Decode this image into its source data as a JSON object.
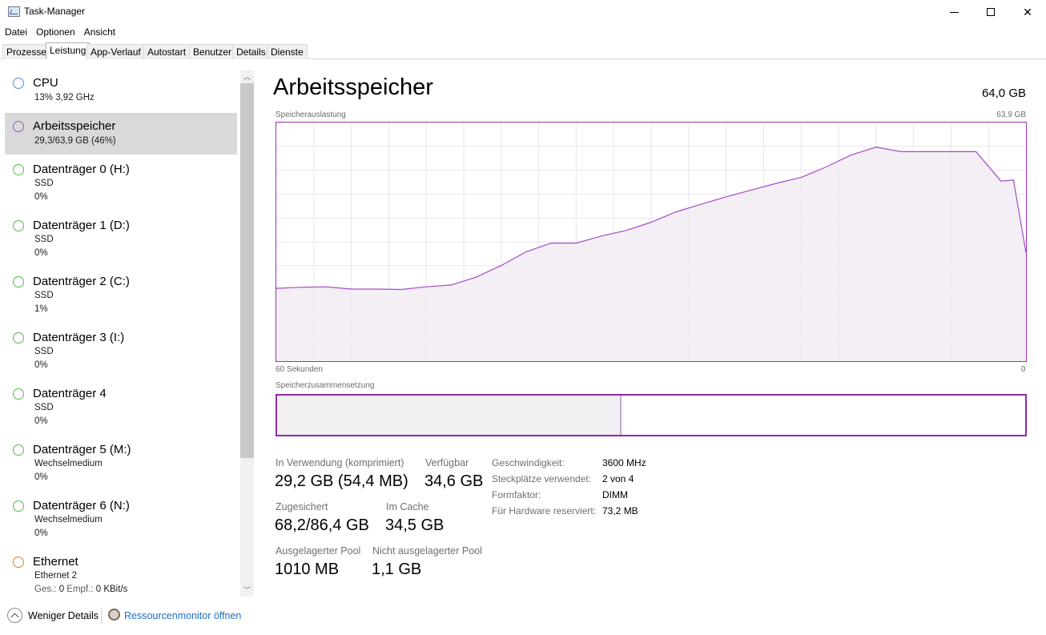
{
  "window": {
    "title": "Task-Manager"
  },
  "menu": [
    "Datei",
    "Optionen",
    "Ansicht"
  ],
  "tabs": [
    "Prozesse",
    "Leistung",
    "App-Verlauf",
    "Autostart",
    "Benutzer",
    "Details",
    "Dienste"
  ],
  "active_tab": "Leistung",
  "sidebar": [
    {
      "title": "CPU",
      "sub1": "13%  3,92 GHz",
      "color": "#4a90d9",
      "selected": false
    },
    {
      "title": "Arbeitsspeicher",
      "sub1": "29,3/63,9 GB (46%)",
      "color": "#a24cc8",
      "selected": true
    },
    {
      "title": "Datenträger 0 (H:)",
      "sub1": "SSD",
      "sub2": "0%",
      "color": "#57b84c",
      "selected": false
    },
    {
      "title": "Datenträger 1 (D:)",
      "sub1": "SSD",
      "sub2": "0%",
      "color": "#57b84c",
      "selected": false
    },
    {
      "title": "Datenträger 2 (C:)",
      "sub1": "SSD",
      "sub2": "1%",
      "color": "#57b84c",
      "selected": false
    },
    {
      "title": "Datenträger 3 (I:)",
      "sub1": "SSD",
      "sub2": "0%",
      "color": "#57b84c",
      "selected": false
    },
    {
      "title": "Datenträger 4",
      "sub1": "SSD",
      "sub2": "0%",
      "color": "#57b84c",
      "selected": false
    },
    {
      "title": "Datenträger 5 (M:)",
      "sub1": "Wechselmedium",
      "sub2": "0%",
      "color": "#57b84c",
      "selected": false
    },
    {
      "title": "Datenträger 6 (N:)",
      "sub1": "Wechselmedium",
      "sub2": "0%",
      "color": "#57b84c",
      "selected": false
    },
    {
      "title": "Ethernet",
      "sub1": "Ethernet 2",
      "sub2_label1": "Ges.:",
      "sub2_val1": "0",
      "sub2_label2": "Empf.:",
      "sub2_val2": "0 KBit/s",
      "color": "#d9822b",
      "selected": false
    }
  ],
  "main": {
    "title": "Arbeitsspeicher",
    "total": "64,0 GB",
    "graph_label": "Speicherauslastung",
    "graph_max_label": "63,9 GB",
    "graph_left_label": "60 Sekunden",
    "graph_right_label": "0",
    "composition_label": "Speicherzusammensetzung"
  },
  "stats": {
    "in_use_label": "In Verwendung (komprimiert)",
    "in_use_value": "29,2 GB (54,4 MB)",
    "available_label": "Verfügbar",
    "available_value": "34,6 GB",
    "committed_label": "Zugesichert",
    "committed_value": "68,2/86,4 GB",
    "cached_label": "Im Cache",
    "cached_value": "34,5 GB",
    "paged_label": "Ausgelagerter Pool",
    "paged_value": "1010 MB",
    "nonpaged_label": "Nicht ausgelagerter Pool",
    "nonpaged_value": "1,1 GB"
  },
  "specs": [
    {
      "label": "Geschwindigkeit:",
      "value": "3600 MHz"
    },
    {
      "label": "Steckplätze verwendet:",
      "value": "2 von 4"
    },
    {
      "label": "Formfaktor:",
      "value": "DIMM"
    },
    {
      "label": "Für Hardware reserviert:",
      "value": "73,2 MB"
    }
  ],
  "footer": {
    "less_details": "Weniger Details",
    "resource_monitor": "Ressourcenmonitor öffnen"
  },
  "chart_data": {
    "type": "area",
    "title": "Speicherauslastung",
    "xlabel": "",
    "ylabel": "",
    "xlim": [
      60,
      0
    ],
    "ylim": [
      0,
      63.9
    ],
    "x": [
      60,
      58,
      56,
      54,
      52,
      50,
      48,
      46,
      44,
      42,
      40,
      38,
      36,
      34,
      32,
      30,
      28,
      26,
      24,
      22,
      20,
      18,
      16,
      14,
      12,
      10,
      8,
      6,
      4,
      2,
      1,
      0
    ],
    "series": [
      {
        "values": [
          19.5,
          19.8,
          19.9,
          19.3,
          19.3,
          19.2,
          19.9,
          20.4,
          22.5,
          25.6,
          29.3,
          31.6,
          31.6,
          33.5,
          35.0,
          37.2,
          40.0,
          42.0,
          44.0,
          45.8,
          47.6,
          49.2,
          52.0,
          55.2,
          57.3,
          56.1,
          56.1,
          56.1,
          56.1,
          48.2,
          48.5,
          29.0
        ],
        "color": "#a24cc8"
      }
    ],
    "composition": {
      "in_use_fraction": 0.46
    },
    "grid": true
  }
}
